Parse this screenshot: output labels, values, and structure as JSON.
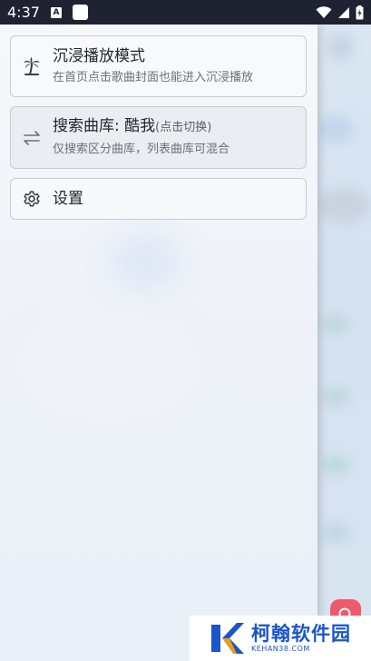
{
  "status_bar": {
    "time": "4:37",
    "notification_badge": "A"
  },
  "drawer": {
    "items": [
      {
        "icon": "palm-tree-icon",
        "title": "沉浸播放模式",
        "subtitle": "在首页点击歌曲封面也能进入沉浸播放"
      },
      {
        "icon": "swap-arrows-icon",
        "title": "搜索曲库: 酷我",
        "title_hint": "(点击切换)",
        "subtitle": "仅搜索区分曲库，列表曲库可混合"
      },
      {
        "icon": "gear-icon",
        "title": "设置"
      }
    ]
  },
  "watermark": {
    "brand": "柯翰软件园",
    "domain": "KEHAN38.COM"
  },
  "colors": {
    "status_bar": "#1f2230",
    "fab": "#ef5a6a",
    "watermark_blue": "#1a56c8"
  }
}
